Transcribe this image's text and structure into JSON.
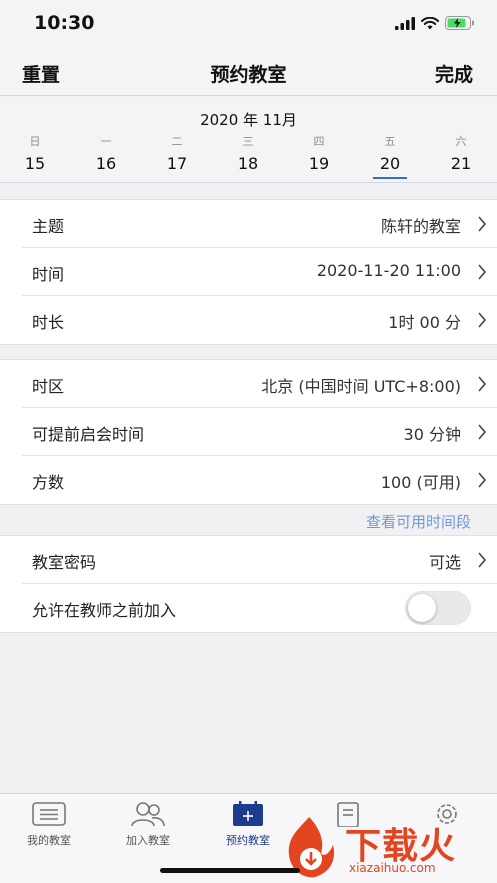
{
  "status_bar": {
    "time": "10:30"
  },
  "nav": {
    "left": "重置",
    "title": "预约教室",
    "right": "完成"
  },
  "calendar": {
    "month": "2020 年 11月",
    "days": [
      {
        "weekday": "日",
        "date": "15"
      },
      {
        "weekday": "一",
        "date": "16"
      },
      {
        "weekday": "二",
        "date": "17"
      },
      {
        "weekday": "三",
        "date": "18"
      },
      {
        "weekday": "四",
        "date": "19"
      },
      {
        "weekday": "五",
        "date": "20",
        "selected": true
      },
      {
        "weekday": "六",
        "date": "21"
      }
    ]
  },
  "group1": [
    {
      "label": "主题",
      "value": "陈轩的教室"
    },
    {
      "label": "时间",
      "value": "2020-11-20 11:00"
    },
    {
      "label": "时长",
      "value": "1时 00 分"
    }
  ],
  "group2": [
    {
      "label": "时区",
      "value": "北京 (中国时间 UTC+8:00)"
    },
    {
      "label": "可提前启会时间",
      "value": "30 分钟"
    },
    {
      "label": "方数",
      "value": "100 (可用)"
    }
  ],
  "hint_link": "查看可用时间段",
  "group3": {
    "password": {
      "label": "教室密码",
      "value": "可选"
    },
    "allow_before_teacher": {
      "label": "允许在教师之前加入",
      "enabled": false
    }
  },
  "tabs": [
    {
      "label": "我的教室",
      "icon": "list-icon"
    },
    {
      "label": "加入教室",
      "icon": "people-icon"
    },
    {
      "label": "预约教室",
      "icon": "calendar-plus-icon",
      "active": true
    },
    {
      "label": "",
      "icon": "document-icon"
    },
    {
      "label": "",
      "icon": "gear-icon"
    }
  ],
  "watermark": {
    "text": "下载火",
    "sub": "xiazaihuo.com"
  },
  "colors": {
    "accent": "#2f6fcf",
    "tab_active": "#1c3c8c",
    "link": "#6d9ad6",
    "watermark": "#e2451f"
  }
}
